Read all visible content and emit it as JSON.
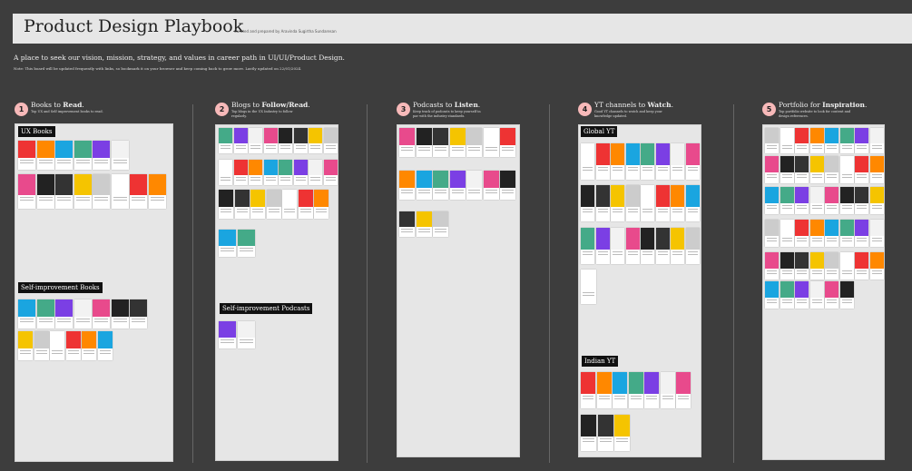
{
  "header": {
    "title": "Product Design Playbook",
    "credit": "Curated and prepared by Aravinda Sugirtha Sundaresan"
  },
  "subtitle": "A place to seek our vision, mission, strategy, and values in career path in UI/UI/Product Design.",
  "note": "Note: This board will be updated frequently with links, so bookmark it on your browser and keep coming back to grow more. Lastly updated on 22/01/2024.",
  "sections": [
    {
      "num": "1",
      "title_pre": "Books to ",
      "title_bold": "Read",
      "desc": "Top UX and Self improvement books to read."
    },
    {
      "num": "2",
      "title_pre": "Blogs to ",
      "title_bold": "Follow/Read",
      "desc": "Top blogs in the UX Industry to follow regularly."
    },
    {
      "num": "3",
      "title_pre": "Podcasts to ",
      "title_bold": "Listen",
      "desc": "Keep track of podcasts to keep yourself in par with the industry standards."
    },
    {
      "num": "4",
      "title_pre": "YT channels to ",
      "title_bold": "Watch",
      "desc": "Good YT channels to watch and keep your knowledge updated."
    },
    {
      "num": "5",
      "title_pre": "Portfolio for ",
      "title_bold": "Inspiration",
      "desc": "Top portfolio website to look for content and design references."
    }
  ],
  "labels": {
    "ux_books": "UX Books",
    "self_books": "Self-improvement Books",
    "self_podcasts": "Self-improvement Podcasts",
    "global_yt": "Global YT",
    "indian_yt": "Indian YT"
  }
}
